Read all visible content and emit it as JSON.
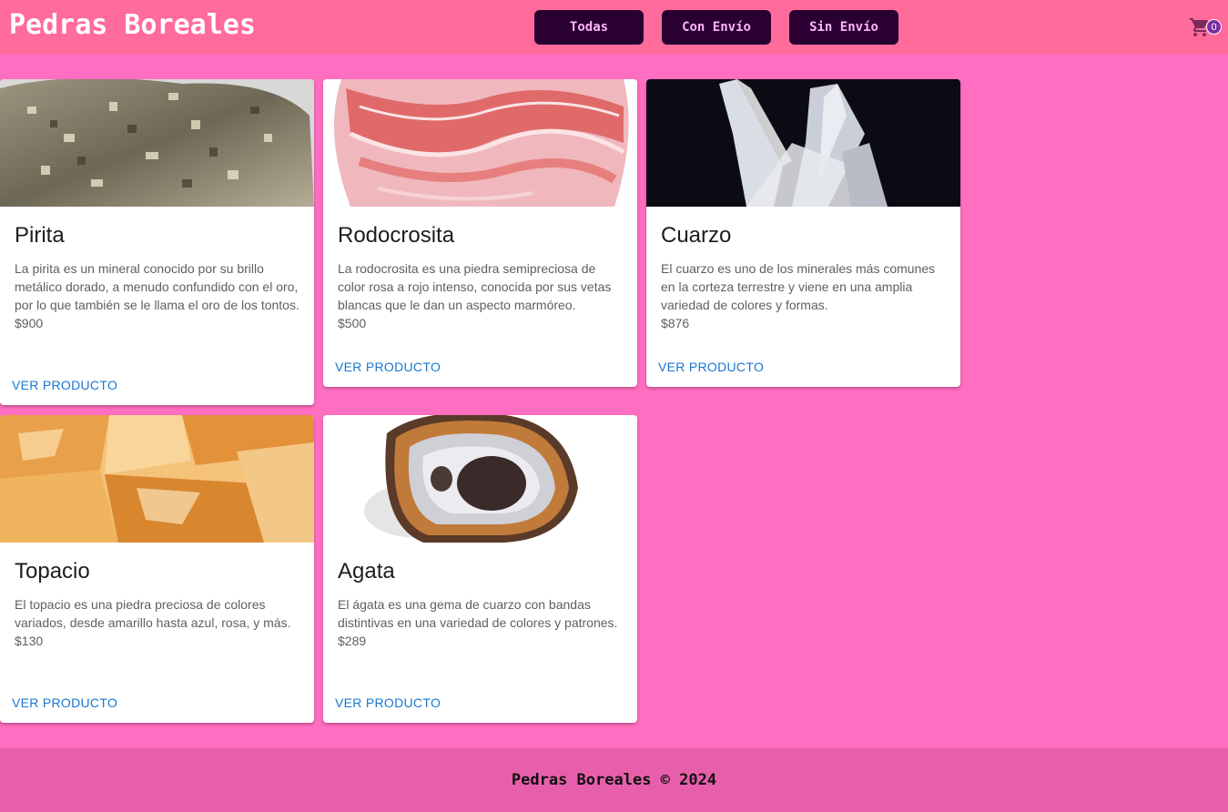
{
  "brand": "Pedras Boreales",
  "nav": {
    "buttons": [
      {
        "label": "Todas"
      },
      {
        "label": "Con Envío"
      },
      {
        "label": "Sin Envío"
      }
    ]
  },
  "cart": {
    "count": "0",
    "icon": "shopping-cart-icon"
  },
  "products": [
    {
      "name": "Pirita",
      "description": "La pirita es un mineral conocido por su brillo metálico dorado, a menudo confundido con el oro, por lo que también se le llama el oro de los tontos.",
      "price": "$900",
      "action": "VER PRODUCTO"
    },
    {
      "name": "Rodocrosita",
      "description": "La rodocrosita es una piedra semipreciosa de color rosa a rojo intenso, conocida por sus vetas blancas que le dan un aspecto marmóreo.",
      "price": "$500",
      "action": "VER PRODUCTO"
    },
    {
      "name": "Cuarzo",
      "description": "El cuarzo es uno de los minerales más comunes en la corteza terrestre y viene en una amplia variedad de colores y formas.",
      "price": "$876",
      "action": "VER PRODUCTO"
    },
    {
      "name": "Topacio",
      "description": "El topacio es una piedra preciosa de colores variados, desde amarillo hasta azul, rosa, y más.",
      "price": "$130",
      "action": "VER PRODUCTO"
    },
    {
      "name": "Agata",
      "description": "El ágata es una gema de cuarzo con bandas distintivas en una variedad de colores y patrones.",
      "price": "$289",
      "action": "VER PRODUCTO"
    }
  ],
  "footer": "Pedras Boreales © 2024",
  "colors": {
    "navbar": "#ff6b9b",
    "background": "#ff6ec0",
    "footer": "#e75fab",
    "nav_button": "#2a0032",
    "link": "#1976d2"
  }
}
